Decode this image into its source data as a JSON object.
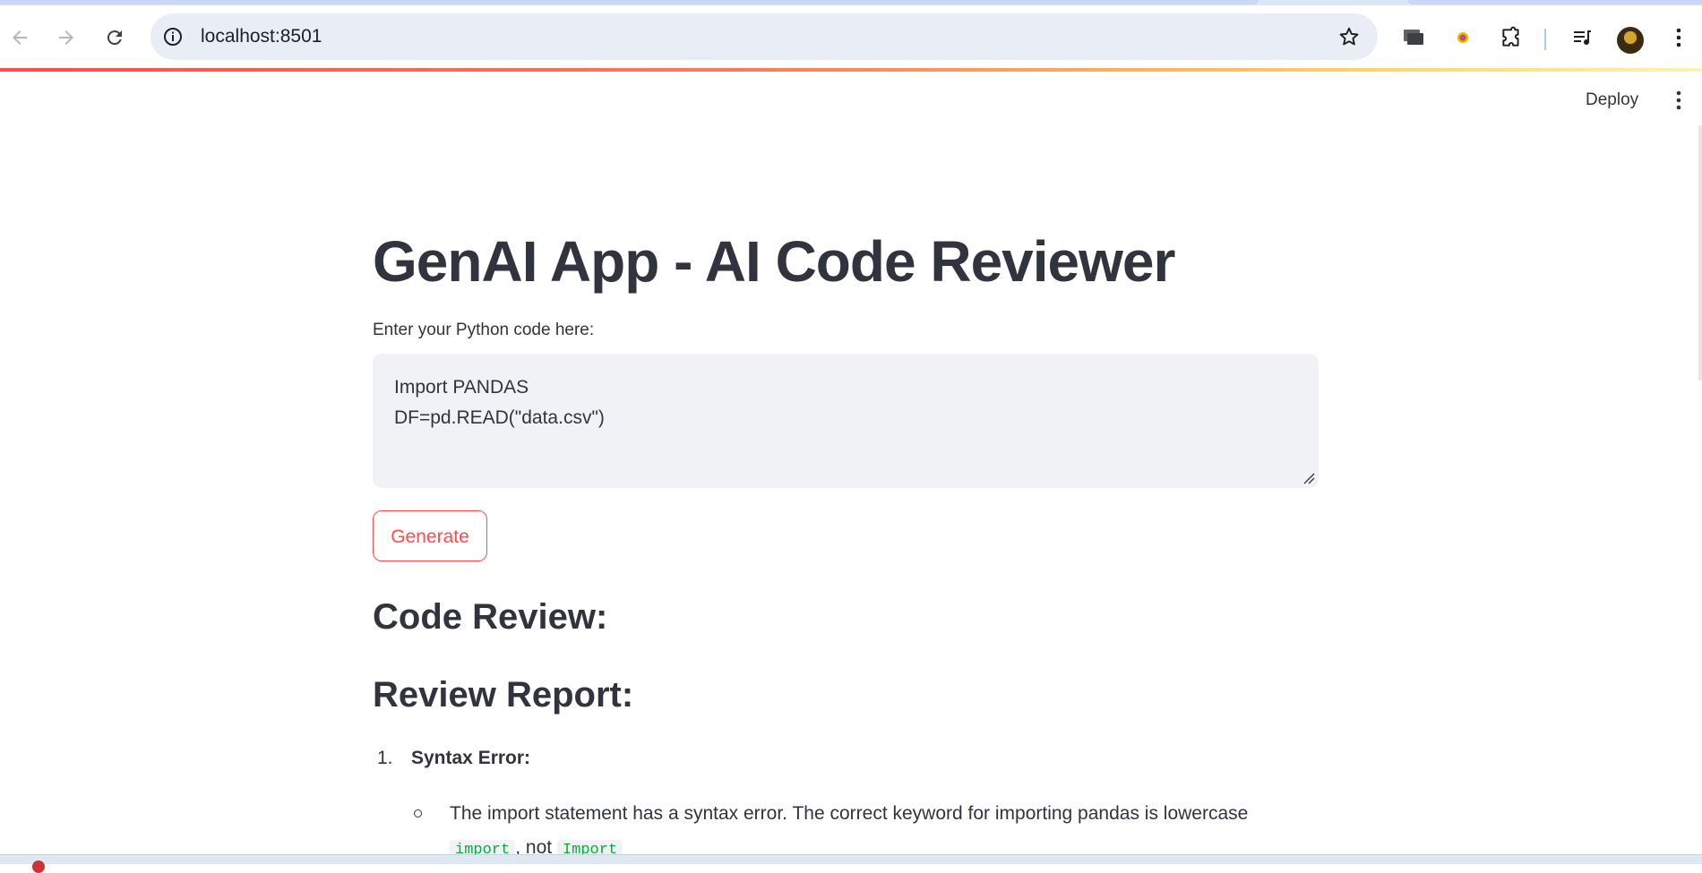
{
  "browser": {
    "url": "localhost:8501",
    "icons": {
      "back": "back-arrow-icon",
      "forward": "forward-arrow-icon",
      "reload": "reload-icon",
      "site_info": "info-icon",
      "bookmark": "star-icon",
      "cast": "cast-icon",
      "extension_colored": "extension-app-icon",
      "extensions": "puzzle-icon",
      "media": "media-control-icon",
      "profile": "avatar",
      "menu": "kebab-menu-icon"
    }
  },
  "app_header": {
    "deploy_label": "Deploy",
    "menu_icon": "kebab-menu-icon"
  },
  "main": {
    "title": "GenAI App - AI Code Reviewer",
    "input_label": "Enter your Python code here:",
    "code_lines": [
      "Import PANDAS",
      "DF=pd.READ(\"data.csv\")"
    ],
    "generate_label": "Generate",
    "review_heading": "Code Review:",
    "report_heading": "Review Report:",
    "list": [
      {
        "number": "1.",
        "title": "Syntax Error:",
        "bullet_text": "The import statement has a syntax error. The correct keyword for importing pandas is lowercase",
        "bullet_code_a": "import",
        "bullet_mid": ", not",
        "bullet_code_b": "Import"
      }
    ]
  },
  "colors": {
    "accent": "#ff4b4b",
    "text": "#31333f",
    "input_bg": "#f0f2f6",
    "code_green": "#09ab3b",
    "omnibox_bg": "#e9eef6"
  }
}
